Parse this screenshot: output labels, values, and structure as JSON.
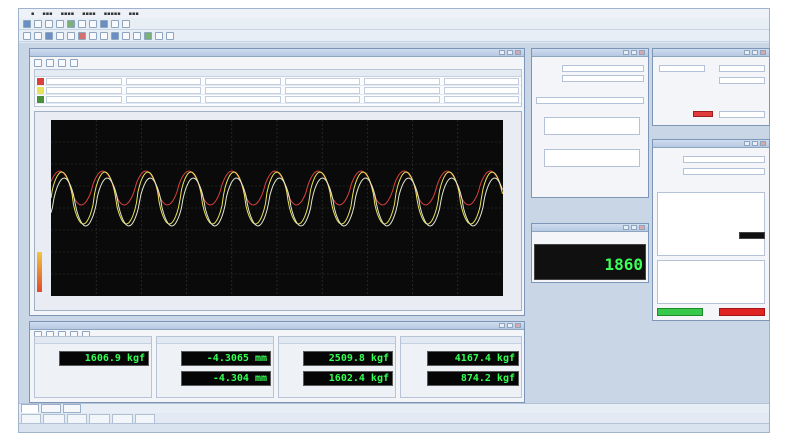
{
  "colors": {
    "trace_yellow": "#e8e25a",
    "trace_red": "#d94040",
    "trace_white": "#dfe8d0",
    "lcd_green": "#35ff52",
    "scope_background": "#0a0a0a"
  },
  "icons": [
    "app-icon",
    "toolbar-icons",
    "window-close-icon",
    "window-maximize-icon",
    "window-minimize-icon"
  ],
  "measurement": {
    "panels": [
      {
        "readouts": [
          {
            "value": "1606.9 kgf"
          }
        ]
      },
      {
        "readouts": [
          {
            "value": "-4.3065 mm"
          },
          {
            "value": "-4.304 mm"
          }
        ]
      },
      {
        "readouts": [
          {
            "value": "2509.8 kgf"
          },
          {
            "value": "1602.4 kgf"
          }
        ]
      },
      {
        "readouts": [
          {
            "value": "4167.4 kgf"
          },
          {
            "value": "874.2 kgf"
          }
        ]
      }
    ]
  },
  "digital_display": {
    "value": "1860"
  }
}
